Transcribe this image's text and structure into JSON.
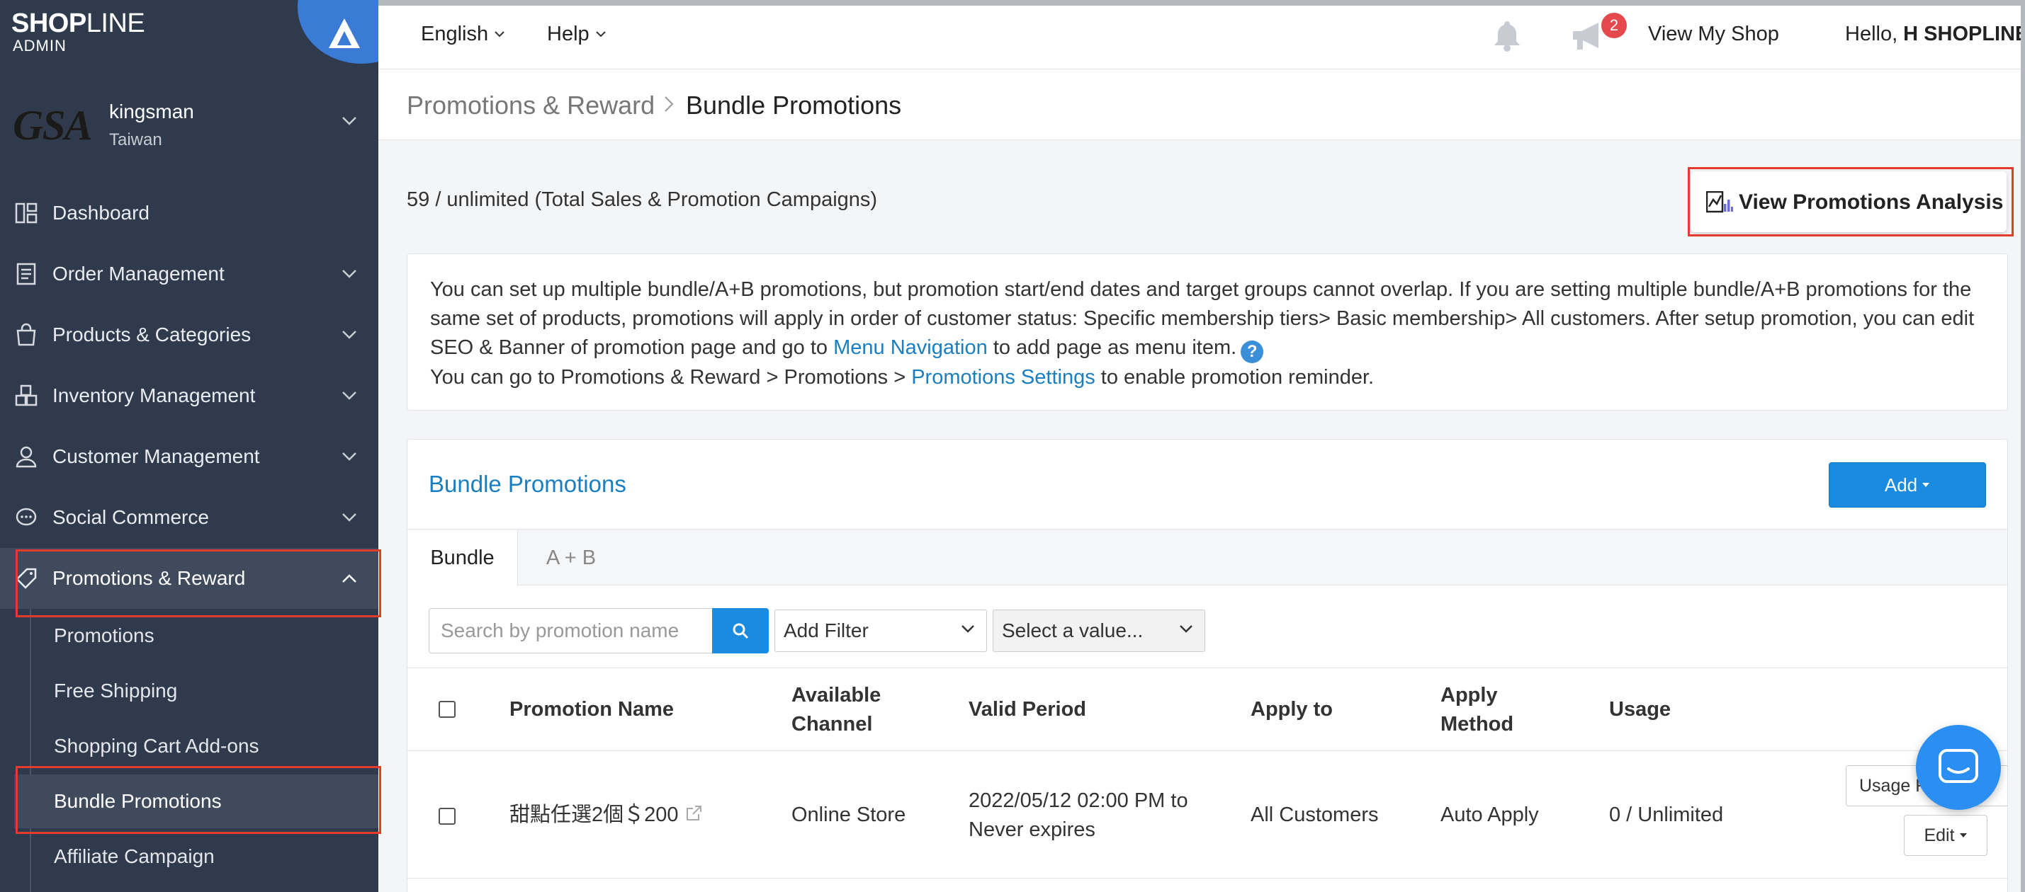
{
  "sidebar": {
    "logo": {
      "brand_a": "SHOP",
      "brand_b": "LINE",
      "sub": "ADMIN"
    },
    "store": {
      "logo_text": "GSA",
      "name": "kingsman",
      "region": "Taiwan"
    },
    "items": [
      {
        "label": "Dashboard",
        "icon": "dashboard-icon"
      },
      {
        "label": "Order Management",
        "icon": "clipboard-icon"
      },
      {
        "label": "Products & Categories",
        "icon": "shopping-bag-icon"
      },
      {
        "label": "Inventory Management",
        "icon": "boxes-icon"
      },
      {
        "label": "Customer Management",
        "icon": "user-icon"
      },
      {
        "label": "Social Commerce",
        "icon": "chat-icon"
      },
      {
        "label": "Promotions & Reward",
        "icon": "tag-icon"
      }
    ],
    "sub_items": [
      {
        "label": "Promotions"
      },
      {
        "label": "Free Shipping"
      },
      {
        "label": "Shopping Cart Add-ons"
      },
      {
        "label": "Bundle Promotions"
      },
      {
        "label": "Affiliate Campaign"
      }
    ]
  },
  "topbar": {
    "language": "English",
    "help": "Help",
    "notification_count": "2",
    "view_shop": "View My Shop",
    "greeting": "Hello,",
    "user": "H SHOPLINE"
  },
  "breadcrumb": {
    "parent": "Promotions & Reward",
    "current": "Bundle Promotions"
  },
  "main": {
    "quota": "59 / unlimited (Total Sales & Promotion Campaigns)",
    "analysis_button": "View Promotions Analysis",
    "info": {
      "line1": "You can set up multiple bundle/A+B promotions, but promotion start/end dates and target groups cannot overlap. If you are setting multiple bundle/A+B promotions for the same set of products, promotions will apply in order of customer status: Specific membership tiers> Basic membership> All customers. After setup promotion, you can edit SEO & Banner of promotion page and go to",
      "link1": "Menu Navigation",
      "line1_end": "to add page as menu item.",
      "help": "?",
      "line2": "You can go to Promotions & Reward > Promotions >",
      "link2": "Promotions Settings",
      "line2_end": "to enable promotion reminder."
    },
    "card": {
      "title": "Bundle Promotions",
      "add_button": "Add",
      "tabs": [
        {
          "label": "Bundle"
        },
        {
          "label": "A + B"
        }
      ],
      "search_placeholder": "Search by promotion name",
      "filter_label": "Add Filter",
      "value_label": "Select a value...",
      "columns": {
        "name": "Promotion Name",
        "channel_a": "Available",
        "channel_b": "Channel",
        "period": "Valid Period",
        "apply_to": "Apply to",
        "method_a": "Apply",
        "method_b": "Method",
        "usage": "Usage"
      },
      "rows": [
        {
          "name": "甜點任選2個＄200",
          "channel": "Online Store",
          "period_a": "2022/05/12 02:00 PM to",
          "period_b": "Never expires",
          "apply_to": "All Customers",
          "method": "Auto Apply",
          "usage": "0 / Unlimited",
          "usage_button": "Usage Report",
          "edit_button": "Edit"
        }
      ]
    }
  },
  "colors": {
    "sidebar": "#2f3a4c",
    "accent": "#1b8be0",
    "link": "#1a7fc1",
    "highlight": "#e53b2c"
  }
}
